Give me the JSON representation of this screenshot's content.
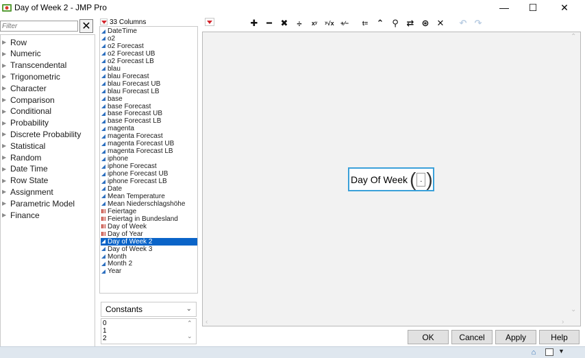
{
  "window": {
    "title": "Day of Week 2 - JMP Pro",
    "minimize": "—",
    "maximize": "☐",
    "close": "✕"
  },
  "functions": {
    "filter_placeholder": "Filter",
    "clear_icon": "✕",
    "categories": [
      "Row",
      "Numeric",
      "Transcendental",
      "Trigonometric",
      "Character",
      "Comparison",
      "Conditional",
      "Probability",
      "Discrete Probability",
      "Statistical",
      "Random",
      "Date Time",
      "Row State",
      "Assignment",
      "Parametric Model",
      "Finance"
    ]
  },
  "columns": {
    "header": "33 Columns",
    "items": [
      {
        "label": "DateTime",
        "type": "continuous"
      },
      {
        "label": "o2",
        "type": "continuous"
      },
      {
        "label": "o2 Forecast",
        "type": "continuous"
      },
      {
        "label": "o2 Forecast UB",
        "type": "continuous"
      },
      {
        "label": "o2 Forecast LB",
        "type": "continuous"
      },
      {
        "label": "blau",
        "type": "continuous"
      },
      {
        "label": "blau Forecast",
        "type": "continuous"
      },
      {
        "label": "blau Forecast UB",
        "type": "continuous"
      },
      {
        "label": "blau Forecast LB",
        "type": "continuous"
      },
      {
        "label": "base",
        "type": "continuous"
      },
      {
        "label": "base Forecast",
        "type": "continuous"
      },
      {
        "label": "base Forecast UB",
        "type": "continuous"
      },
      {
        "label": "base Forecast LB",
        "type": "continuous"
      },
      {
        "label": "magenta",
        "type": "continuous"
      },
      {
        "label": "magenta Forecast",
        "type": "continuous"
      },
      {
        "label": "magenta Forecast UB",
        "type": "continuous"
      },
      {
        "label": "magenta Forecast LB",
        "type": "continuous"
      },
      {
        "label": "iphone",
        "type": "continuous"
      },
      {
        "label": "iphone Forecast",
        "type": "continuous"
      },
      {
        "label": "iphone Forecast UB",
        "type": "continuous"
      },
      {
        "label": "iphone Forecast LB",
        "type": "continuous"
      },
      {
        "label": "Date",
        "type": "continuous"
      },
      {
        "label": "Mean Temperature",
        "type": "continuous"
      },
      {
        "label": "Mean Niederschlagshöhe",
        "type": "continuous"
      },
      {
        "label": "Feiertage",
        "type": "nominal"
      },
      {
        "label": "Feiertag in Bundesland",
        "type": "nominal"
      },
      {
        "label": "Day of Week",
        "type": "nominal"
      },
      {
        "label": "Day of Year",
        "type": "nominal"
      },
      {
        "label": "Day of Week 2",
        "type": "continuous",
        "selected": true
      },
      {
        "label": "Day of Week 3",
        "type": "continuous"
      },
      {
        "label": "Month",
        "type": "continuous"
      },
      {
        "label": "Month 2",
        "type": "continuous"
      },
      {
        "label": "Year",
        "type": "continuous"
      }
    ]
  },
  "constants": {
    "dropdown_label": "Constants",
    "values": [
      "0",
      "1",
      "2"
    ]
  },
  "toolbar": {
    "buttons": [
      {
        "name": "add-icon",
        "glyph": "✚"
      },
      {
        "name": "subtract-icon",
        "glyph": "━"
      },
      {
        "name": "multiply-icon",
        "glyph": "✖"
      },
      {
        "name": "divide-icon",
        "glyph": "÷"
      },
      {
        "name": "power-icon",
        "glyph": "xʸ"
      },
      {
        "name": "root-icon",
        "glyph": "ʸ√x"
      },
      {
        "name": "sign-change-icon",
        "glyph": "+∕−"
      },
      {
        "name": "local-variable-icon",
        "glyph": "t="
      },
      {
        "name": "peel-icon",
        "glyph": "⌃"
      },
      {
        "name": "unthrow-icon",
        "glyph": "⚲"
      },
      {
        "name": "swap-icon",
        "glyph": "⇄"
      },
      {
        "name": "evaluate-icon",
        "glyph": "⊛"
      },
      {
        "name": "delete-icon",
        "glyph": "✕"
      }
    ],
    "undo_icon": "↶",
    "redo_icon": "↷"
  },
  "formula": {
    "function_name": "Day Of Week",
    "argument": "."
  },
  "buttons": {
    "ok": "OK",
    "cancel": "Cancel",
    "apply": "Apply",
    "help": "Help"
  },
  "statusbar": {
    "home_icon": "⌂",
    "menu_icon": "▼"
  },
  "colors": {
    "selection": "#0a64c8",
    "formula_border": "#3aa0d9",
    "red_triangle": "#d3242b",
    "continuous_icon": "#2c6fbf",
    "nominal_icon": "#c0392b"
  }
}
